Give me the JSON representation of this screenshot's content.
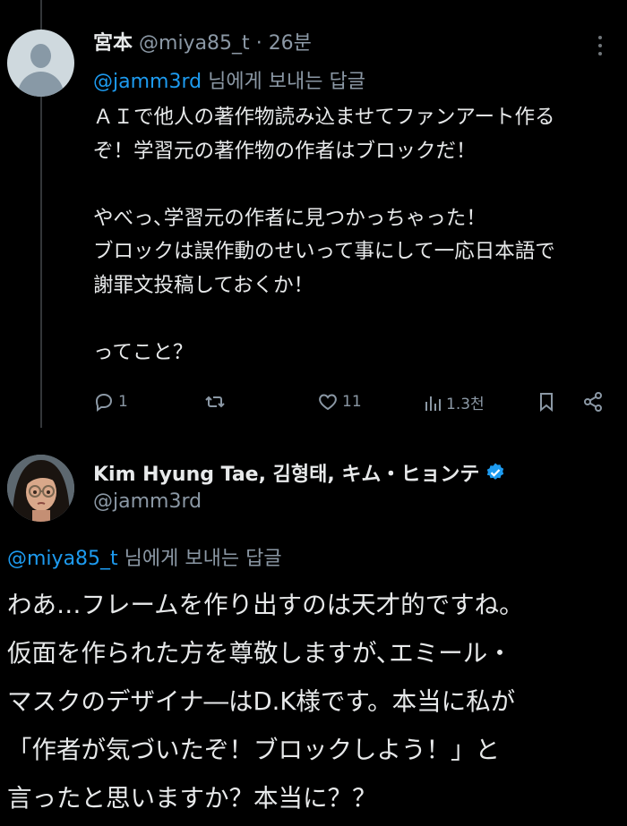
{
  "tweet1": {
    "name": "宮本",
    "handle": "@miya85_t",
    "separator": "·",
    "time": "26분",
    "reply_mention": "@jamm3rd",
    "reply_suffix": "님에게 보내는 답글",
    "lines": [
      "ＡＩで他人の著作物読み込ませてファンアート作る",
      "ぞ！学習元の著作物の作者はブロックだ！",
      "",
      "やべっ､学習元の作者に見つかっちゃった！",
      "ブロックは誤作動のせいって事にして一応日本語で",
      "謝罪文投稿しておくか！",
      "",
      "ってこと？"
    ],
    "actions": {
      "reply_count": "1",
      "retweet_count": "",
      "like_count": "11",
      "view_count": "1.3천"
    },
    "icons": [
      "reply-icon",
      "retweet-icon",
      "like-icon",
      "views-icon",
      "bookmark-icon",
      "share-icon",
      "more-icon",
      "default-avatar-icon"
    ]
  },
  "tweet2": {
    "name": "Kim Hyung Tae, 김형태, キム・ヒョンテ",
    "handle": "@jamm3rd",
    "verified": true,
    "reply_mention": "@miya85_t",
    "reply_suffix": "님에게 보내는 답글",
    "lines": [
      "わあ…フレームを作り出すのは天才的ですね。",
      "仮面を作られた方を尊敬しますが､エミール・",
      "マスクのデザイナ―はD.K様です。本当に私が",
      "「作者が気づいたぞ！ブロックしよう！」と",
      "言ったと思いますか？本当に？？"
    ]
  },
  "colors": {
    "background": "#000000",
    "text": "#e7e9ea",
    "muted": "#8b98a5",
    "accent": "#1d9bf0",
    "thread_line": "#333639"
  }
}
